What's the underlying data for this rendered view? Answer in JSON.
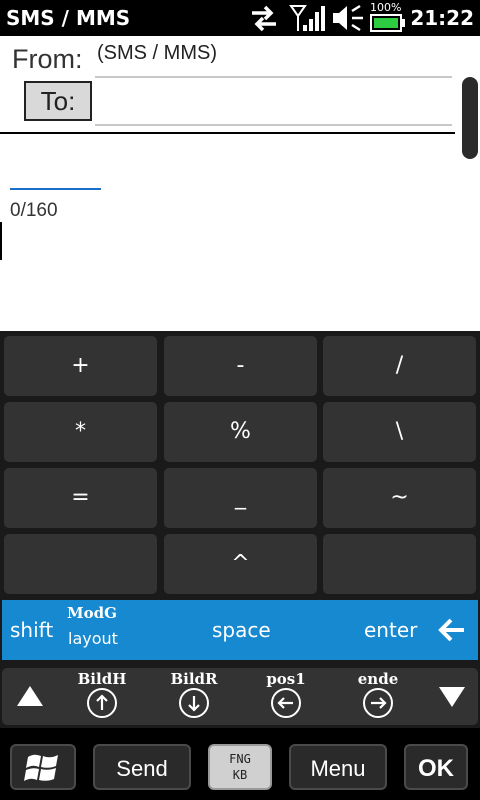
{
  "status": {
    "title": "SMS / MMS",
    "time": "21:22",
    "battery_percent": "100%",
    "signal_icon": "signal-icon",
    "sync_icon": "data-sync-icon",
    "volume_icon": "volume-icon"
  },
  "header": {
    "from_label": "From:",
    "from_value": "(SMS / MMS)",
    "to_label": "To:",
    "to_value": ""
  },
  "message": {
    "counter": "0/160"
  },
  "keyboard": {
    "keys": [
      [
        "+",
        "-",
        "/"
      ],
      [
        "*",
        "%",
        "\\"
      ],
      [
        "=",
        "_",
        "~"
      ],
      [
        "",
        "^",
        ""
      ]
    ],
    "blue_row": {
      "shift": "shift",
      "modg": "ModG",
      "layout": "layout",
      "space": "space",
      "enter": "enter",
      "backspace": "←"
    },
    "nav_row": {
      "bildh": "BildH",
      "bildr": "BildR",
      "pos1": "pos1",
      "ende": "ende"
    }
  },
  "bottom": {
    "send": "Send",
    "kb_line1": "FNG",
    "kb_line2": "KB",
    "menu": "Menu",
    "ok": "OK"
  },
  "colors": {
    "accent": "#1789d0",
    "key_bg": "#333333",
    "battery": "#2ecc40"
  }
}
